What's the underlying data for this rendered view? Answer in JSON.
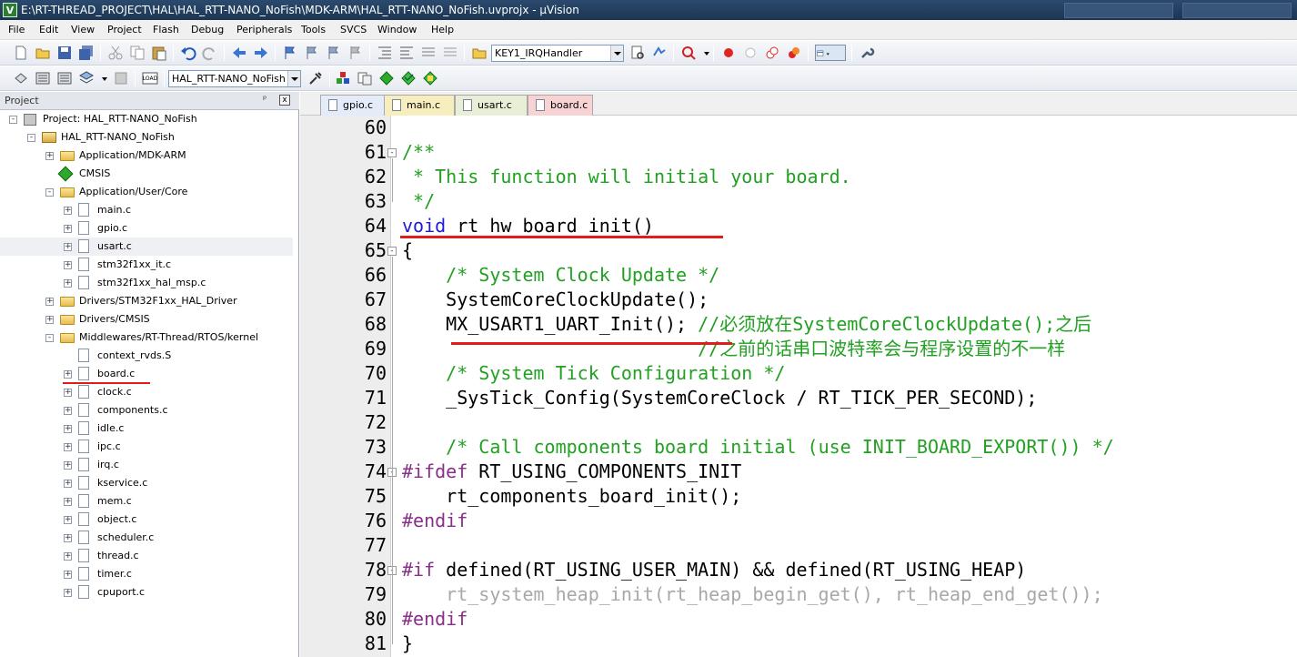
{
  "window": {
    "title": "E:\\RT-THREAD_PROJECT\\HAL\\HAL_RTT-NANO_NoFish\\MDK-ARM\\HAL_RTT-NANO_NoFish.uvprojx - µVision"
  },
  "menu": [
    "File",
    "Edit",
    "View",
    "Project",
    "Flash",
    "Debug",
    "Peripherals",
    "Tools",
    "SVCS",
    "Window",
    "Help"
  ],
  "toolbar": {
    "function_combo": "KEY1_IRQHandler",
    "target_combo": "HAL_RTT-NANO_NoFish"
  },
  "project_panel": {
    "title": "Project",
    "pin": "ᵖ",
    "close": "x",
    "tree": [
      {
        "label": "Project: HAL_RTT-NANO_NoFish",
        "depth": 0,
        "icon": "root-icon",
        "exp": "-"
      },
      {
        "label": "HAL_RTT-NANO_NoFish",
        "depth": 1,
        "icon": "target-icon",
        "exp": "-"
      },
      {
        "label": "Application/MDK-ARM",
        "depth": 2,
        "icon": "folder-icon",
        "exp": "+"
      },
      {
        "label": "CMSIS",
        "depth": 2,
        "icon": "cmsis-icon",
        "exp": ""
      },
      {
        "label": "Application/User/Core",
        "depth": 2,
        "icon": "folder-icon",
        "exp": "-"
      },
      {
        "label": "main.c",
        "depth": 3,
        "icon": "file-icon",
        "exp": "+"
      },
      {
        "label": "gpio.c",
        "depth": 3,
        "icon": "file-icon",
        "exp": "+"
      },
      {
        "label": "usart.c",
        "depth": 3,
        "icon": "file-icon",
        "exp": "+",
        "selected": true
      },
      {
        "label": "stm32f1xx_it.c",
        "depth": 3,
        "icon": "file-icon",
        "exp": "+"
      },
      {
        "label": "stm32f1xx_hal_msp.c",
        "depth": 3,
        "icon": "file-icon",
        "exp": "+"
      },
      {
        "label": "Drivers/STM32F1xx_HAL_Driver",
        "depth": 2,
        "icon": "folder-icon",
        "exp": "+"
      },
      {
        "label": "Drivers/CMSIS",
        "depth": 2,
        "icon": "folder-icon",
        "exp": "+"
      },
      {
        "label": "Middlewares/RT-Thread/RTOS/kernel",
        "depth": 2,
        "icon": "folder-icon",
        "exp": "-"
      },
      {
        "label": "context_rvds.S",
        "depth": 3,
        "icon": "file-icon",
        "exp": ""
      },
      {
        "label": "board.c",
        "depth": 3,
        "icon": "file-icon",
        "exp": "+"
      },
      {
        "label": "clock.c",
        "depth": 3,
        "icon": "file-icon",
        "exp": "+"
      },
      {
        "label": "components.c",
        "depth": 3,
        "icon": "file-icon",
        "exp": "+"
      },
      {
        "label": "idle.c",
        "depth": 3,
        "icon": "file-icon",
        "exp": "+"
      },
      {
        "label": "ipc.c",
        "depth": 3,
        "icon": "file-icon",
        "exp": "+"
      },
      {
        "label": "irq.c",
        "depth": 3,
        "icon": "file-icon",
        "exp": "+"
      },
      {
        "label": "kservice.c",
        "depth": 3,
        "icon": "file-icon",
        "exp": "+"
      },
      {
        "label": "mem.c",
        "depth": 3,
        "icon": "file-icon",
        "exp": "+"
      },
      {
        "label": "object.c",
        "depth": 3,
        "icon": "file-icon",
        "exp": "+"
      },
      {
        "label": "scheduler.c",
        "depth": 3,
        "icon": "file-icon",
        "exp": "+"
      },
      {
        "label": "thread.c",
        "depth": 3,
        "icon": "file-icon",
        "exp": "+"
      },
      {
        "label": "timer.c",
        "depth": 3,
        "icon": "file-icon",
        "exp": "+"
      },
      {
        "label": "cpuport.c",
        "depth": 3,
        "icon": "file-icon",
        "exp": "+"
      }
    ]
  },
  "tabs": [
    {
      "label": "gpio.c",
      "color": "#e3ecf8",
      "active": false
    },
    {
      "label": "main.c",
      "color": "#f6efbd",
      "active": false
    },
    {
      "label": "usart.c",
      "color": "#e8efd6",
      "active": false
    },
    {
      "label": "board.c",
      "color": "#f7d3d3",
      "active": true
    }
  ],
  "editor": {
    "lines": [
      {
        "n": "60",
        "segs": []
      },
      {
        "n": "61",
        "fold": "-",
        "segs": [
          {
            "c": "cm",
            "t": "/**"
          }
        ]
      },
      {
        "n": "62",
        "segs": [
          {
            "c": "cm",
            "t": " * This function will initial your board."
          }
        ]
      },
      {
        "n": "63",
        "segs": [
          {
            "c": "cm",
            "t": " */"
          }
        ]
      },
      {
        "n": "64",
        "segs": [
          {
            "c": "kw",
            "t": "void"
          },
          {
            "c": "",
            "t": " rt_hw_board_init()"
          }
        ]
      },
      {
        "n": "65",
        "fold": "-",
        "segs": [
          {
            "c": "",
            "t": "{"
          }
        ]
      },
      {
        "n": "66",
        "segs": [
          {
            "c": "",
            "t": "    "
          },
          {
            "c": "cm",
            "t": "/* System Clock Update */"
          }
        ]
      },
      {
        "n": "67",
        "segs": [
          {
            "c": "",
            "t": "    SystemCoreClockUpdate();"
          }
        ]
      },
      {
        "n": "68",
        "segs": [
          {
            "c": "",
            "t": "    MX_USART1_UART_Init(); "
          },
          {
            "c": "cm",
            "t": "//必须放在SystemCoreClockUpdate();之后"
          }
        ]
      },
      {
        "n": "69",
        "segs": [
          {
            "c": "",
            "t": "                           "
          },
          {
            "c": "cm",
            "t": "//之前的话串口波特率会与程序设置的不一样"
          }
        ]
      },
      {
        "n": "70",
        "segs": [
          {
            "c": "",
            "t": "    "
          },
          {
            "c": "cm",
            "t": "/* System Tick Configuration */"
          }
        ]
      },
      {
        "n": "71",
        "segs": [
          {
            "c": "",
            "t": "    _SysTick_Config(SystemCoreClock / RT_TICK_PER_SECOND);"
          }
        ]
      },
      {
        "n": "72",
        "segs": []
      },
      {
        "n": "73",
        "segs": [
          {
            "c": "",
            "t": "    "
          },
          {
            "c": "cm",
            "t": "/* Call components board initial (use INIT_BOARD_EXPORT()) */"
          }
        ]
      },
      {
        "n": "74",
        "fold": "-",
        "segs": [
          {
            "c": "pp",
            "t": "#ifdef"
          },
          {
            "c": "",
            "t": " RT_USING_COMPONENTS_INIT"
          }
        ]
      },
      {
        "n": "75",
        "segs": [
          {
            "c": "",
            "t": "    rt_components_board_init();"
          }
        ]
      },
      {
        "n": "76",
        "segs": [
          {
            "c": "pp",
            "t": "#endif"
          }
        ]
      },
      {
        "n": "77",
        "segs": []
      },
      {
        "n": "78",
        "fold": "-",
        "segs": [
          {
            "c": "pp",
            "t": "#if"
          },
          {
            "c": "",
            "t": " defined(RT_USING_USER_MAIN) && defined(RT_USING_HEAP)"
          }
        ]
      },
      {
        "n": "79",
        "segs": [
          {
            "c": "dim",
            "t": "    rt_system_heap_init(rt_heap_begin_get(), rt_heap_end_get());"
          }
        ]
      },
      {
        "n": "80",
        "segs": [
          {
            "c": "pp",
            "t": "#endif"
          }
        ]
      },
      {
        "n": "81",
        "segs": [
          {
            "c": "",
            "t": "}"
          }
        ]
      }
    ]
  },
  "colors": {
    "annotation_underline": "#e21b1b",
    "keyword": "#1b1bd9",
    "comment": "#22a022",
    "preprocessor": "#8a2e8a"
  }
}
